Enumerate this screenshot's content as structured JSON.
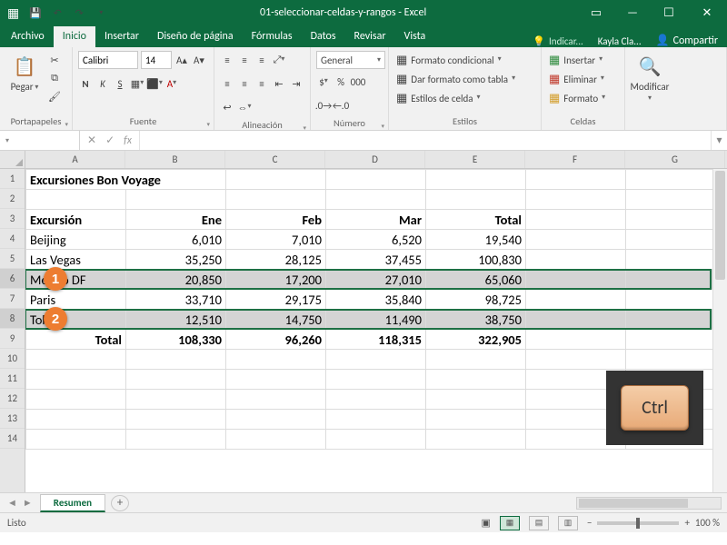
{
  "titlebar": {
    "filename": "01-seleccionar-celdas-y-rangos",
    "app": "Excel"
  },
  "tabs": {
    "file": "Archivo",
    "home": "Inicio",
    "insert": "Insertar",
    "layout": "Diseño de página",
    "formulas": "Fórmulas",
    "data": "Datos",
    "review": "Revisar",
    "view": "Vista",
    "tellme": "Indicar...",
    "account": "Kayla Cla...",
    "share": "Compartir"
  },
  "ribbon": {
    "clipboard": {
      "paste": "Pegar",
      "label": "Portapapeles"
    },
    "font": {
      "name": "Calibri",
      "size": "14",
      "bold": "N",
      "italic": "K",
      "underline": "S",
      "label": "Fuente"
    },
    "alignment": {
      "label": "Alineación"
    },
    "number": {
      "format": "General",
      "label": "Número"
    },
    "styles": {
      "cond": "Formato condicional",
      "table": "Dar formato como tabla",
      "cell": "Estilos de celda",
      "label": "Estilos"
    },
    "cells": {
      "insert": "Insertar",
      "delete": "Eliminar",
      "format": "Formato",
      "label": "Celdas"
    },
    "editing": {
      "modify": "Modificar"
    }
  },
  "formula_bar": {
    "namebox": "",
    "fx": "fx",
    "value": ""
  },
  "columns": [
    "A",
    "B",
    "C",
    "D",
    "E",
    "F",
    "G"
  ],
  "rows": [
    "1",
    "2",
    "3",
    "4",
    "5",
    "6",
    "7",
    "8",
    "9",
    "10",
    "11",
    "12",
    "13",
    "14"
  ],
  "sheet": {
    "title": "Excursiones Bon Voyage",
    "headers": {
      "a": "Excursión",
      "b": "Ene",
      "c": "Feb",
      "d": "Mar",
      "e": "Total"
    },
    "data": [
      {
        "a": "Beijing",
        "b": "6,010",
        "c": "7,010",
        "d": "6,520",
        "e": "19,540"
      },
      {
        "a": "Las Vegas",
        "b": "35,250",
        "c": "28,125",
        "d": "37,455",
        "e": "100,830"
      },
      {
        "a": "México DF",
        "b": "20,850",
        "c": "17,200",
        "d": "27,010",
        "e": "65,060"
      },
      {
        "a": "Paris",
        "b": "33,710",
        "c": "29,175",
        "d": "35,840",
        "e": "98,725"
      },
      {
        "a": "Tokyo",
        "b": "12,510",
        "c": "14,750",
        "d": "11,490",
        "e": "38,750"
      }
    ],
    "totals": {
      "label": "Total",
      "b": "108,330",
      "c": "96,260",
      "d": "118,315",
      "e": "322,905"
    }
  },
  "sheet_tab": "Resumen",
  "status": {
    "ready": "Listo",
    "zoom": "100 %"
  },
  "annotations": {
    "one": "1",
    "two": "2",
    "ctrl": "Ctrl"
  }
}
